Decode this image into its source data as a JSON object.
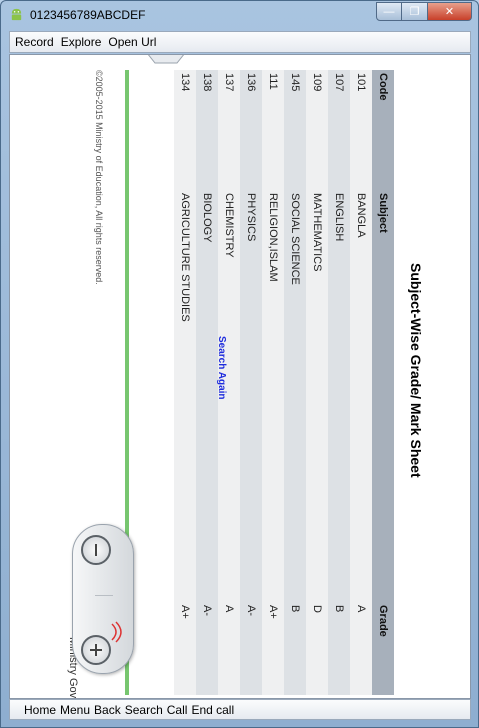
{
  "window": {
    "title": "0123456789ABCDEF",
    "controls": {
      "minimize": "—",
      "maximize": "❐",
      "close": "✕"
    }
  },
  "menubar": {
    "items": [
      "Record",
      "Explore",
      "Open Url"
    ]
  },
  "page": {
    "heading": "Subject-Wise Grade/ Mark Sheet",
    "table": {
      "headers": [
        "Code",
        "Subject",
        "Grade"
      ],
      "rows": [
        {
          "code": "101",
          "subject": "BANGLA",
          "grade": "A"
        },
        {
          "code": "107",
          "subject": "ENGLISH",
          "grade": "B"
        },
        {
          "code": "109",
          "subject": "MATHEMATICS",
          "grade": "D"
        },
        {
          "code": "145",
          "subject": "SOCIAL SCIENCE",
          "grade": "B"
        },
        {
          "code": "111",
          "subject": "RELIGION,ISLAM",
          "grade": "A+"
        },
        {
          "code": "136",
          "subject": "PHYSICS",
          "grade": "A-"
        },
        {
          "code": "137",
          "subject": "CHEMISTRY",
          "grade": "A"
        },
        {
          "code": "138",
          "subject": "BIOLOGY",
          "grade": "A-"
        },
        {
          "code": "134",
          "subject": "AGRICULTURE STUDIES",
          "grade": "A+"
        }
      ]
    },
    "search_again": "Search Again",
    "copyright": "©2005-2015 Ministry of Education, All rights reserved.",
    "cutoff_text": "Ministry  Gov"
  },
  "zoom": {
    "minus_icon": "zoom-out-icon",
    "plus_icon": "zoom-in-icon"
  },
  "bottombar": {
    "items": [
      "Home",
      "Menu",
      "Back",
      "Search",
      "Call",
      "End call"
    ]
  }
}
